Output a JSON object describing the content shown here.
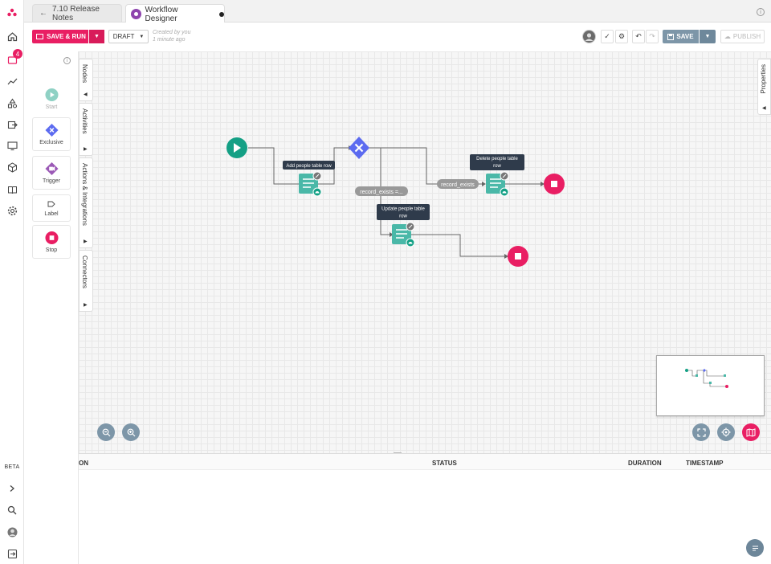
{
  "tabs": [
    {
      "label": "7.10 Release Notes"
    },
    {
      "label": "Workflow Designer"
    }
  ],
  "rail": {
    "notifications_badge": "4",
    "beta_label": "BETA"
  },
  "toolbar": {
    "save_run_label": "SAVE & RUN",
    "draft_label": "DRAFT",
    "created_line1": "Created by you",
    "created_line2": "1 minute ago",
    "save_label": "SAVE",
    "publish_label": "PUBLISH"
  },
  "palette": {
    "items": [
      {
        "label": "Start"
      },
      {
        "label": "Exclusive"
      },
      {
        "label": "Trigger"
      },
      {
        "label": "Label"
      },
      {
        "label": "Stop"
      }
    ]
  },
  "side_tabs": [
    "Nodes",
    "Activities",
    "Actions & Integrations",
    "Connectors"
  ],
  "properties_tab": "Properties",
  "canvas": {
    "nodes": {
      "add_row": "Add people table row",
      "delete_row_line1": "Delete people table",
      "delete_row_line2": "row",
      "update_row_line1": "Update people table",
      "update_row_line2": "row"
    },
    "edges": {
      "record_exists": "record_exists",
      "record_exists_eq": "record_exists =..."
    }
  },
  "results_table": {
    "columns": [
      "ON",
      "STATUS",
      "DURATION",
      "TIMESTAMP"
    ]
  },
  "colors": {
    "accent": "#e91e63",
    "teal": "#14a085",
    "node_teal": "#4ab8a8",
    "exclusive": "#5c6bf0",
    "trigger": "#9b59b6",
    "save": "#7d96a8"
  }
}
